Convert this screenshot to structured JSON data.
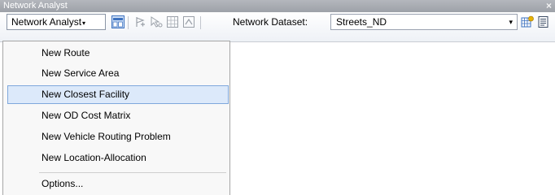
{
  "window": {
    "title": "Network Analyst",
    "close_glyph": "×"
  },
  "toolbar": {
    "menu_button_label": "Network Analyst",
    "menu_button_arrow": "▾",
    "network_dataset_label": "Network Dataset:",
    "network_dataset_value": "Streets_ND",
    "dropdown_arrow": "▾",
    "icons": [
      "network-analyst-window-icon",
      "create-network-location-icon",
      "select-move-location-icon",
      "network-identify-icon",
      "solve-icon",
      "build-network-icon",
      "network-directions-icon"
    ]
  },
  "menu": {
    "items": [
      {
        "label": "New Route"
      },
      {
        "label": "New Service Area"
      },
      {
        "label": "New Closest Facility",
        "highlighted": true
      },
      {
        "label": "New OD Cost Matrix"
      },
      {
        "label": "New Vehicle Routing Problem"
      },
      {
        "label": "New Location-Allocation"
      },
      {
        "label": "Options..."
      }
    ]
  },
  "colors": {
    "highlight_fill": "#dce9fa",
    "highlight_border": "#7fa8dc",
    "titlebar": "#a9adb3"
  }
}
